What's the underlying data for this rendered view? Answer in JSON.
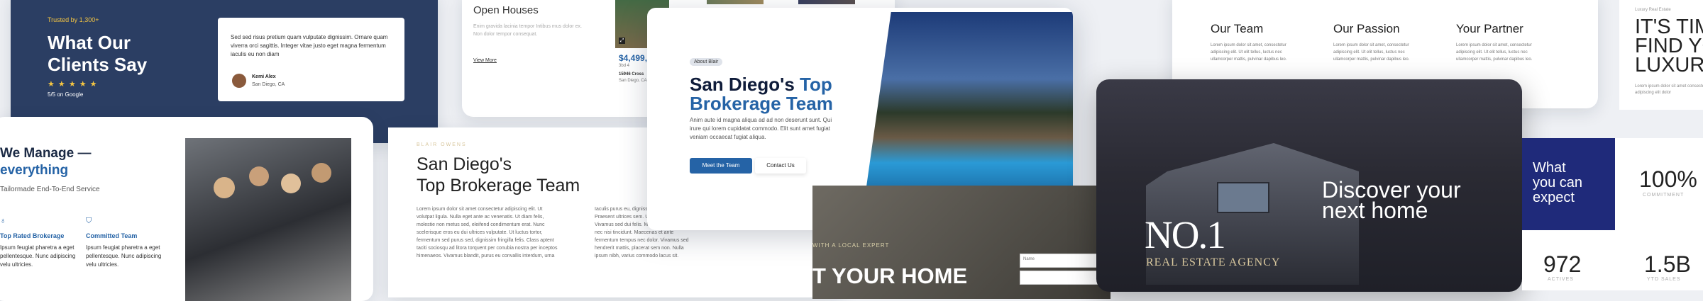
{
  "testimonial": {
    "trusted": "Trusted by 1,300+",
    "title_line1": "What Our",
    "title_line2": "Clients Say",
    "stars": "★ ★ ★ ★ ★",
    "rating": "5/5 on Google",
    "quote": "Sed sed risus pretium quam vulputate dignissim. Ornare quam viverra orci sagittis. Integer vitae justo eget magna fermentum iaculis eu non diam",
    "author_name": "Kemi Alex",
    "author_location": "San Diego, CA"
  },
  "openhouses": {
    "title": "Open Houses",
    "body": "Enim gravida lacinia tempor Intibus mus dolor ex. Non dolor tempor consequat.",
    "link": "View More",
    "price": "$4,499,",
    "meta": "3bd 4",
    "address": "15946 Cross",
    "city": "San Diego, CA"
  },
  "manage": {
    "title_line1": "We Manage —",
    "title_line2": "everything",
    "subtitle": "Tailormade End-To-End Service",
    "feature1_title": "Top Rated Brokerage",
    "feature1_body": "Ipsum feugiat pharetra a eget pellentesque. Nunc adipiscing velu ultricies.",
    "feature2_title": "Committed Team",
    "feature2_body": "Ipsum feugiat pharetra a eget pellentesque. Nunc adipiscing velu ultricies."
  },
  "team": {
    "kicker": "BLAIR OWENS",
    "title_line1": "San Diego's",
    "title_line2": "Top Brokerage Team",
    "col1": "Lorem ipsum dolor sit amet consectetur adipiscing elit. Ut volutpat ligula. Nulla eget ante ac venenatis. Ut diam felis, molestie non metus sed, eleifend condimentum erat. Nunc scelerisque eros eu dui ultrices vulputate. Ut luctus tortor, fermentum sed purus sed, dignissim fringilla felis. Class aptent taciti sociosqu ad litora torquent per conubia nostra per inceptos himenaeos. Vivamus blandit, purus eu convallis interdum, urna",
    "col2": "Iaculis purus eu, dignissim accumsan. Praesent ultrices sem. Ut volutpat sagittis erat. Vivamus sed dui felis. Morbi pellentesque nisi nec nisi tincidunt. Maecenas et ante fermentum tempus nec dolor. Vivamus sed hendrerit mattis, placerat sem non. Nulla ipsum nibh, varius commodo lacus sit."
  },
  "hero": {
    "badge": "About Blair",
    "title_line1_a": "San Diego's ",
    "title_line1_b": "Top",
    "title_line2": "Brokerage Team",
    "body": "Anim aute id magna aliqua ad ad non deserunt sunt. Qui irure qui lorem cupidatat commodo. Elit sunt amet fugiat veniam occaecat fugiat aliqua.",
    "primary_button": "Meet the Team",
    "secondary_button": "Contact Us"
  },
  "values": {
    "col1_title": "Our Team",
    "col1_body": "Lorem ipsum dolor sit amet, consectetur adipiscing elit. Ut elit tellus, luctus nec ullamcorper mattis, pulvinar dapibus leo.",
    "col2_title": "Our Passion",
    "col2_body": "Lorem ipsum dolor sit amet, consectetur adipiscing elit. Ut elit tellus, luctus nec ullamcorper mattis, pulvinar dapibus leo.",
    "col3_title": "Your Partner",
    "col3_body": "Lorem ipsum dolor sit amet, consectetur adipiscing elit. Ut elit tellus, luctus nec ullamcorper mattis, pulvinar dapibus leo."
  },
  "luxury": {
    "kicker": "Luxury Real Estate",
    "title_line1": "IT'S TIME",
    "title_line2": "FIND YOUR",
    "title_line3": "LUXURY",
    "body": "Lorem ipsum dolor sit amet consectetur adipiscing elit dolor"
  },
  "agency": {
    "number": "NO.1",
    "subtitle": "REAL ESTATE AGENCY",
    "tagline_line1": "Discover your",
    "tagline_line2": "next home"
  },
  "expert": {
    "kicker": "WITH A LOCAL EXPERT",
    "title": "T YOUR HOME",
    "field_label": "Name"
  },
  "stats": {
    "expect_line1": "What",
    "expect_line2": "you can",
    "expect_line3": "expect",
    "stat1_value": "100%",
    "stat1_label": "COMMITMENT",
    "stat2_value": "972",
    "stat2_label": "ACTIVES",
    "stat3_value": "1.5B",
    "stat3_label": "YTD SALES"
  },
  "colors": {
    "navy": "#2b3e63",
    "blue": "#2563a6",
    "gold": "#f4c542",
    "deep_blue": "#1f2a7a"
  }
}
